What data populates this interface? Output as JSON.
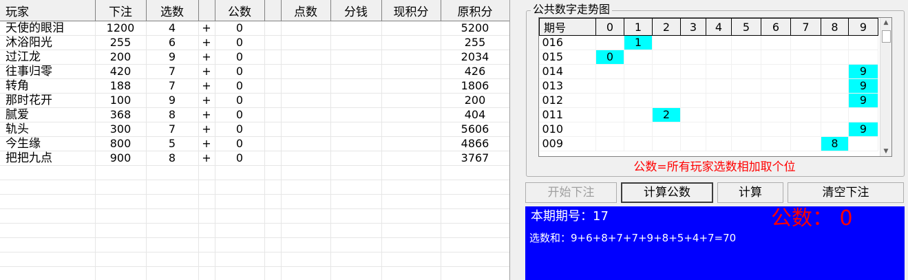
{
  "grid": {
    "headers": [
      "玩家",
      "下注",
      "选数",
      "",
      "公数",
      "",
      "点数",
      "分钱",
      "现积分",
      "原积分"
    ],
    "rows": [
      {
        "name": "天使的眼泪",
        "bet": "1200",
        "pick": "4",
        "op": "+",
        "pub": "0",
        "orig": "5200"
      },
      {
        "name": "沐浴阳光",
        "bet": "255",
        "pick": "6",
        "op": "+",
        "pub": "0",
        "orig": "255"
      },
      {
        "name": "过江龙",
        "bet": "200",
        "pick": "9",
        "op": "+",
        "pub": "0",
        "orig": "2034"
      },
      {
        "name": "往事归零",
        "bet": "420",
        "pick": "7",
        "op": "+",
        "pub": "0",
        "orig": "426"
      },
      {
        "name": "转角",
        "bet": "188",
        "pick": "7",
        "op": "+",
        "pub": "0",
        "orig": "1806"
      },
      {
        "name": "那时花开",
        "bet": "100",
        "pick": "9",
        "op": "+",
        "pub": "0",
        "orig": "200"
      },
      {
        "name": "腻爱",
        "bet": "368",
        "pick": "8",
        "op": "+",
        "pub": "0",
        "orig": "404"
      },
      {
        "name": "轨头",
        "bet": "300",
        "pick": "7",
        "op": "+",
        "pub": "0",
        "orig": "5606"
      },
      {
        "name": "今生缘",
        "bet": "800",
        "pick": "5",
        "op": "+",
        "pub": "0",
        "orig": "4866"
      },
      {
        "name": "把把九点",
        "bet": "900",
        "pick": "8",
        "op": "+",
        "pub": "0",
        "orig": "3767"
      }
    ]
  },
  "trend": {
    "title": "公共数字走势图",
    "period_header": "期号",
    "digits": [
      "0",
      "1",
      "2",
      "3",
      "4",
      "5",
      "6",
      "7",
      "8",
      "9"
    ],
    "rows": [
      {
        "period": "016",
        "value": "1"
      },
      {
        "period": "015",
        "value": "0"
      },
      {
        "period": "014",
        "value": "9"
      },
      {
        "period": "013",
        "value": "9"
      },
      {
        "period": "012",
        "value": "9"
      },
      {
        "period": "011",
        "value": "2"
      },
      {
        "period": "010",
        "value": "9"
      },
      {
        "period": "009",
        "value": "8"
      }
    ],
    "formula": "公数=所有玩家选数相加取个位",
    "highlight_color": "#00ffff"
  },
  "buttons": {
    "start": "开始下注",
    "calc_public": "计算公数",
    "calc": "计算",
    "clear": "清空下注"
  },
  "info": {
    "period_text": "本期期号：17",
    "public_text": "公数： 0",
    "sum_text": "选数和：9+6+8+7+7+9+8+5+4+7=70"
  },
  "colors": {
    "info_bg": "#0000ff",
    "accent_red": "#ff0000"
  }
}
